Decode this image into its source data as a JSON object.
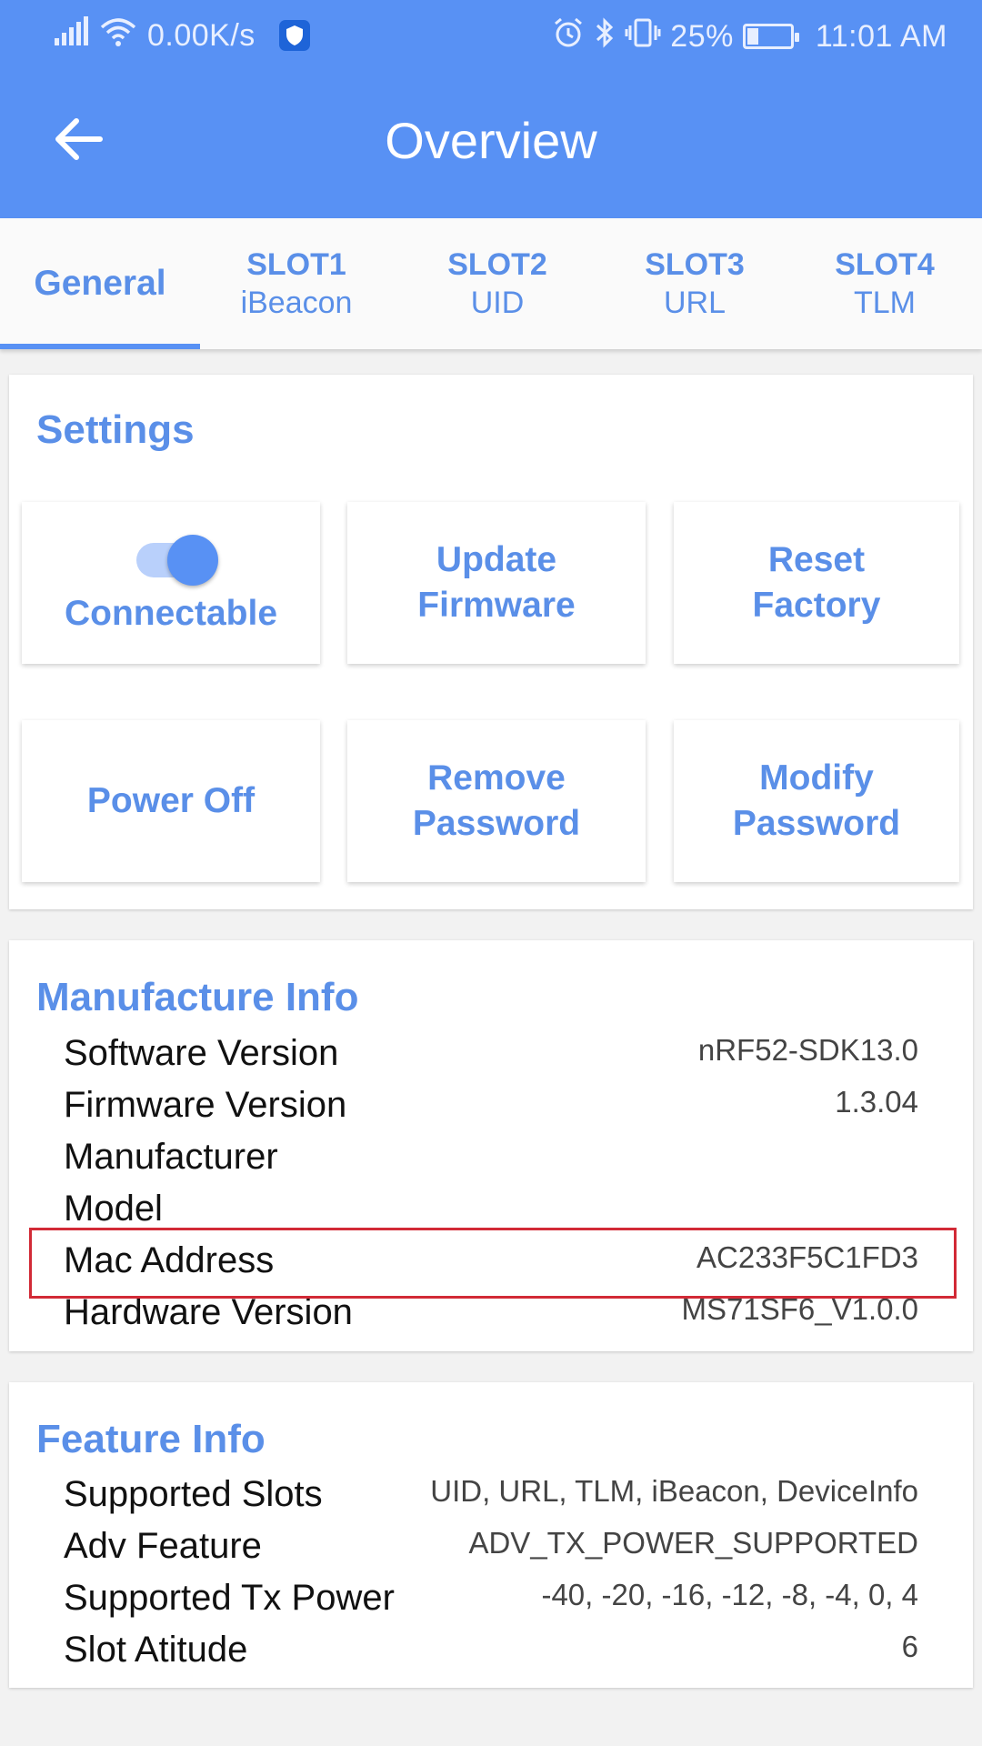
{
  "status_bar": {
    "network_speed": "0.00K/s",
    "battery_percent": "25%",
    "battery_level": 0.25,
    "time": "11:01 AM"
  },
  "app_bar": {
    "title": "Overview"
  },
  "tabs": [
    {
      "line1": "General",
      "line2": ""
    },
    {
      "line1": "SLOT1",
      "line2": "iBeacon"
    },
    {
      "line1": "SLOT2",
      "line2": "UID"
    },
    {
      "line1": "SLOT3",
      "line2": "URL"
    },
    {
      "line1": "SLOT4",
      "line2": "TLM"
    }
  ],
  "settings": {
    "title": "Settings",
    "connectable": {
      "label": "Connectable",
      "on": true
    },
    "update_firmware": {
      "line1": "Update",
      "line2": "Firmware"
    },
    "reset_factory": {
      "line1": "Reset",
      "line2": "Factory"
    },
    "power_off": {
      "line1": "Power Off"
    },
    "remove_password": {
      "line1": "Remove",
      "line2": "Password"
    },
    "modify_password": {
      "line1": "Modify",
      "line2": "Password"
    }
  },
  "manufacture_info": {
    "title": "Manufacture Info",
    "rows": [
      {
        "label": "Software Version",
        "value": "nRF52-SDK13.0"
      },
      {
        "label": "Firmware Version",
        "value": "1.3.04"
      },
      {
        "label": "Manufacturer",
        "value": ""
      },
      {
        "label": "Model",
        "value": ""
      },
      {
        "label": "Mac Address",
        "value": "AC233F5C1FD3"
      },
      {
        "label": "Hardware Version",
        "value": "MS71SF6_V1.0.0"
      }
    ]
  },
  "feature_info": {
    "title": "Feature Info",
    "rows": [
      {
        "label": "Supported Slots",
        "value": "UID, URL, TLM, iBeacon, DeviceInfo"
      },
      {
        "label": "Adv Feature",
        "value": "ADV_TX_POWER_SUPPORTED"
      },
      {
        "label": "Supported Tx Power",
        "value": "-40, -20, -16, -12, -8, -4, 0, 4"
      },
      {
        "label": "Slot Atitude",
        "value": "6"
      }
    ]
  },
  "colors": {
    "primary": "#5891f4",
    "accent_text": "#5a8fe8",
    "highlight_border": "#d22a36"
  }
}
